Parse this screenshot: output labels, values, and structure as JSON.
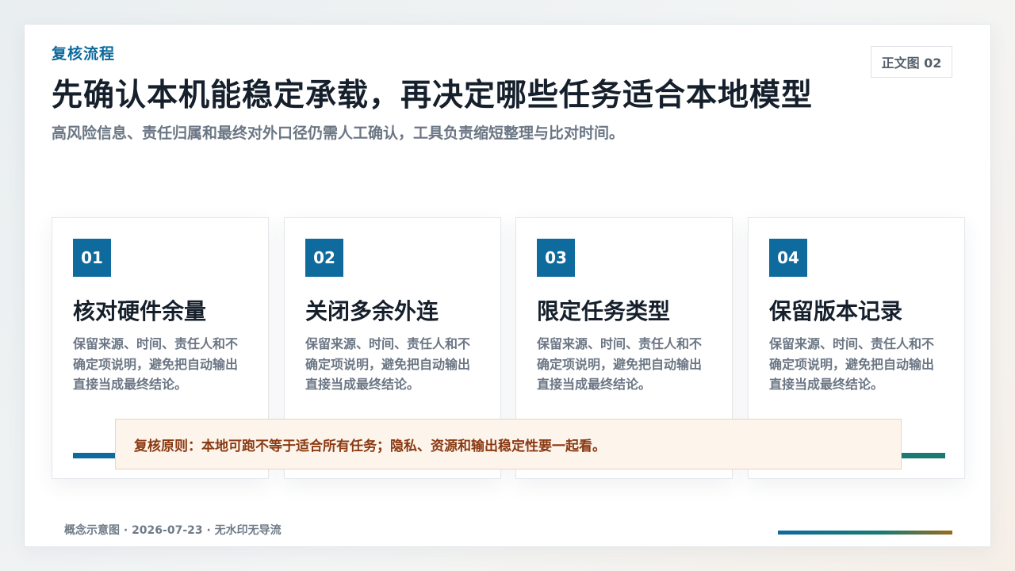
{
  "header": {
    "eyebrow": "复核流程",
    "title": "先确认本机能稳定承载，再决定哪些任务适合本地模型",
    "subtitle": "高风险信息、责任归属和最终对外口径仍需人工确认，工具负责缩短整理与比对时间。",
    "tag": "正文图 02"
  },
  "cards": [
    {
      "num": "01",
      "title": "核对硬件余量",
      "body": "保留来源、时间、责任人和不确定项说明，避免把自动输出直接当成最终结论。",
      "bar_color": "#0f6a9e"
    },
    {
      "num": "02",
      "title": "关闭多余外连",
      "body": "保留来源、时间、责任人和不确定项说明，避免把自动输出直接当成最终结论。",
      "bar_color": "#0f6a9e"
    },
    {
      "num": "03",
      "title": "限定任务类型",
      "body": "保留来源、时间、责任人和不确定项说明，避免把自动输出直接当成最终结论。",
      "bar_color": "#1a7a72"
    },
    {
      "num": "04",
      "title": "保留版本记录",
      "body": "保留来源、时间、责任人和不确定项说明，避免把自动输出直接当成最终结论。",
      "bar_color": "#1a7a72"
    }
  ],
  "note": {
    "text": "复核原则：本地可跑不等于适合所有任务；隐私、资源和输出稳定性要一起看。"
  },
  "footer": {
    "text": "概念示意图 · 2026-07-23 · 无水印无导流"
  },
  "colors": {
    "accent": "#0f6a9e",
    "teal": "#1a7a72",
    "note_text": "#8a3a12",
    "note_bg": "#fdf4ec"
  }
}
